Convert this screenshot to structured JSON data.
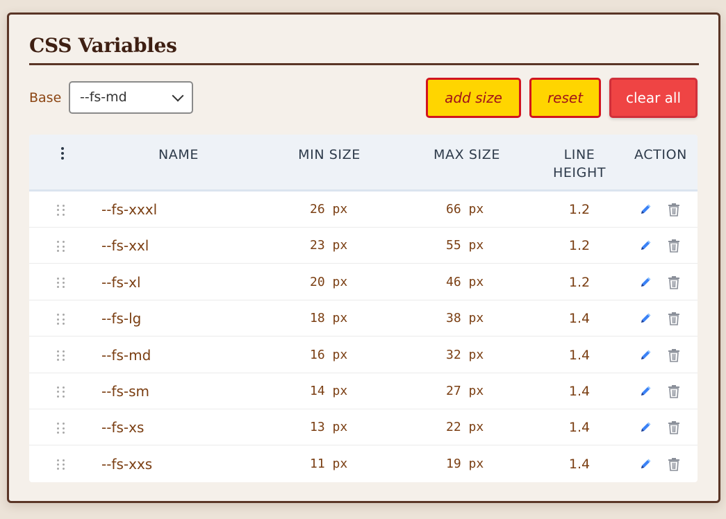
{
  "title": "CSS Variables",
  "base": {
    "label": "Base",
    "selected": "--fs-md"
  },
  "buttons": {
    "add": "add size",
    "reset": "reset",
    "clear": "clear all"
  },
  "columns": {
    "name": "NAME",
    "min": "MIN SIZE",
    "max": "MAX SIZE",
    "line_height_1": "LINE",
    "line_height_2": "HEIGHT",
    "action": "ACTION"
  },
  "rows": [
    {
      "name": "--fs-xxxl",
      "min": "26 px",
      "max": "66 px",
      "lh": "1.2"
    },
    {
      "name": "--fs-xxl",
      "min": "23 px",
      "max": "55 px",
      "lh": "1.2"
    },
    {
      "name": "--fs-xl",
      "min": "20 px",
      "max": "46 px",
      "lh": "1.2"
    },
    {
      "name": "--fs-lg",
      "min": "18 px",
      "max": "38 px",
      "lh": "1.4"
    },
    {
      "name": "--fs-md",
      "min": "16 px",
      "max": "32 px",
      "lh": "1.4"
    },
    {
      "name": "--fs-sm",
      "min": "14 px",
      "max": "27 px",
      "lh": "1.4"
    },
    {
      "name": "--fs-xs",
      "min": "13 px",
      "max": "22 px",
      "lh": "1.4"
    },
    {
      "name": "--fs-xxs",
      "min": "11 px",
      "max": "19 px",
      "lh": "1.4"
    }
  ],
  "icons": {
    "drag_header": "vertical-ellipsis-icon",
    "drag_row": "drag-handle-icon",
    "edit": "pencil-icon",
    "delete": "trash-icon",
    "select": "chevron-down-icon"
  },
  "colors": {
    "accent_yellow": "#ffd500",
    "danger_red": "#ef4444",
    "text_brown": "#7a3e12",
    "border_dark": "#5a3526",
    "edit_blue": "#3b82f6"
  }
}
